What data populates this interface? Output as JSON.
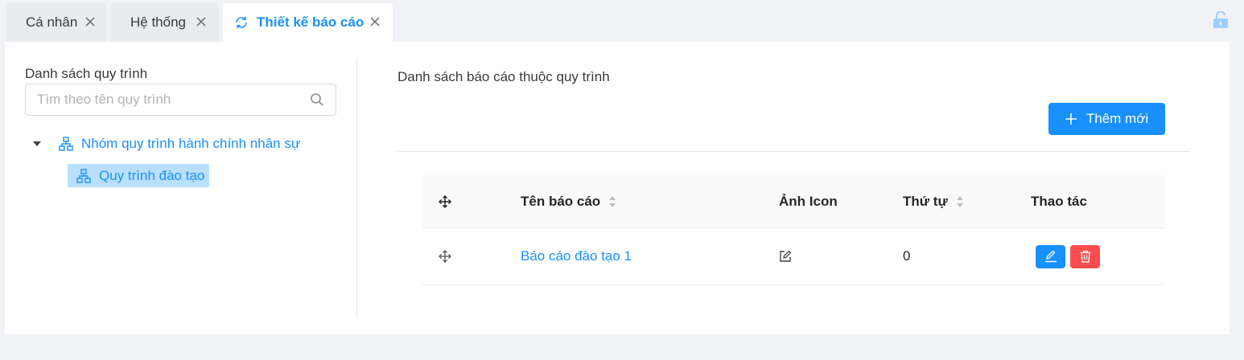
{
  "tabs": [
    {
      "label": "Cá nhân",
      "active": false
    },
    {
      "label": "Hệ thống",
      "active": false
    },
    {
      "label": "Thiết kế báo cáo",
      "active": true
    }
  ],
  "left": {
    "title": "Danh sách quy trình",
    "search_placeholder": "Tìm theo tên quy trình",
    "tree": {
      "group_label": "Nhóm quy trình hành chính nhân sự",
      "child_label": "Quy trình đào tạo"
    }
  },
  "right": {
    "title": "Danh sách báo cáo thuộc quy trình",
    "add_label": "Thêm mới",
    "table": {
      "headers": {
        "name": "Tên báo cáo",
        "icon": "Ảnh Icon",
        "order": "Thứ tự",
        "actions": "Thao tác"
      },
      "rows": [
        {
          "name": "Báo cáo đào tạo 1",
          "order": "0"
        }
      ]
    }
  },
  "colors": {
    "primary": "#1890ff",
    "danger": "#ff4d4f",
    "selected_bg": "#bae0ff"
  }
}
